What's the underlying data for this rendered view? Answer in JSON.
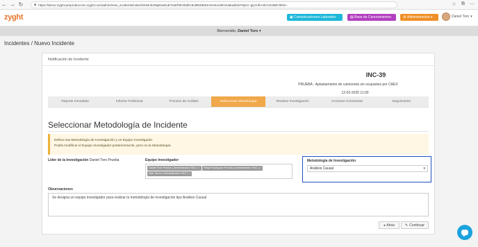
{
  "browser": {
    "url": "https://demo-zyght-preproduccion.zyght.com/admin/new_incidents/index/DKWuh2I9pEIwDub7naKf0EXbdRc5ol993IMIHmXeKe19KGuMudZdcF0pGi--gly7ufIA4KC3rv0BChkhe--"
  },
  "header": {
    "logo": "zyght",
    "btn_comunicaciones": "Comunicaciones Laborales",
    "btn_base": "Base de Conocimientos",
    "btn_admin": "Administración",
    "user_name": "Daniel Toro"
  },
  "welcome": {
    "prefix": "Bienvenido,",
    "name": "Daniel Toro"
  },
  "breadcrumb": "Incidentes / Nuevo Incidente",
  "panel": {
    "heading": "Notificación de Incidente",
    "incident_id": "INC-39",
    "incident_desc": "PRUEBA - Aplastamiento de camioneta sin ocupantes por CAEX",
    "incident_date": "12-02-2025 11:00"
  },
  "steps": [
    {
      "label": "Reporte Inmediato",
      "active": false
    },
    {
      "label": "Informe Preliminar",
      "active": false
    },
    {
      "label": "Proceso de Análisis",
      "active": false
    },
    {
      "label": "Seleccionar Metodología",
      "active": true
    },
    {
      "label": "Realizar Investigación",
      "active": false
    },
    {
      "label": "Acciones Correctivas",
      "active": false
    },
    {
      "label": "Seguimiento",
      "active": false
    }
  ],
  "section_title": "Seleccionar Metodología de Incidente",
  "alert": {
    "line1": "Defina una Metodología de Investigación y un Equipo Investigador.",
    "line2": "Podrá modificar el Equipo Investigador posteriormente, pero no la Metodología."
  },
  "leader": {
    "label": "Lider de la Investigación",
    "value": "Daniel Toro Prueba"
  },
  "team": {
    "label": "Equipo Investigador",
    "members": [
      "Daniel Toro Prueba ( Administrador SSO )",
      "Felipe Rodríguez Prueba ( Administrador SSO )",
      "Iván Torres ( Administrador SSO )"
    ]
  },
  "method": {
    "label": "Metodología de Investigación",
    "value": "Análisis Causal"
  },
  "observations": {
    "label": "Observaciones",
    "value": "Se designa un equipo investigador para realizar la metodología de investigación tipo Análisis Causal"
  },
  "buttons": {
    "back": "Atrás",
    "next": "Continuar"
  },
  "colors": {
    "accent": "#f0a84a",
    "highlight": "#1e4fbf"
  }
}
